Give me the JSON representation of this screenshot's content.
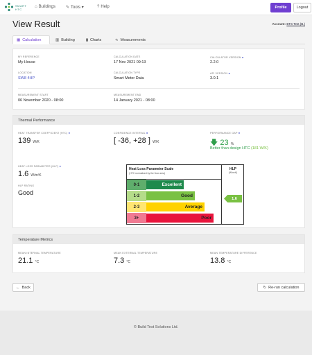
{
  "brand": {
    "line1": "SMART",
    "line2": "HTC"
  },
  "nav": [
    {
      "icon": "⌂",
      "label": "Buildings"
    },
    {
      "icon": "✎",
      "label": "Tools ▾"
    },
    {
      "icon": "?",
      "label": "Help"
    }
  ],
  "header": {
    "profile_label": "Profile",
    "logout_label": "Logout"
  },
  "page": {
    "title": "View Result",
    "account_label": "Account:",
    "account_value": "BTS Test (B.)"
  },
  "tabs": [
    {
      "label": "Calculation"
    },
    {
      "label": "Building"
    },
    {
      "label": "Charts"
    },
    {
      "label": "Measurements"
    }
  ],
  "details": {
    "reference": {
      "label": "My Reference",
      "value": "My House"
    },
    "calc_date": {
      "label": "Calculation Date",
      "value": "17 Nov 2021 09:13"
    },
    "calc_version": {
      "label": "Calculator Version",
      "value": "2.2.0"
    },
    "location": {
      "label": "Location",
      "value": "SW8 4HP"
    },
    "calc_type": {
      "label": "Calculation Type",
      "value": "Smart Meter Data"
    },
    "api_version": {
      "label": "API Version",
      "value": "3.0.1"
    },
    "measurement_start": {
      "label": "Measurement Start",
      "value": "06 November 2020 - 08:00"
    },
    "measurement_end": {
      "label": "Measurement End",
      "value": "14 January 2021 - 08:00"
    }
  },
  "thermal": {
    "title": "Thermal Performance",
    "htc": {
      "label": "Heat Transfer Coefficient (HTC)",
      "value": "139",
      "unit": "W/K"
    },
    "ci": {
      "label": "Confidence Interval",
      "value": "[ -36, +28 ]",
      "unit": "W/K"
    },
    "gap": {
      "label": "Performance Gap",
      "value": "23",
      "unit": "%",
      "note": "Better than design HTC",
      "note_value": "(181 W/K)"
    },
    "hlp": {
      "label": "Heat Loss Parameter (HLP)",
      "value": "1.6",
      "unit": "W/m²K"
    },
    "rating": {
      "label": "HLP Rating",
      "value": "Good"
    }
  },
  "hlp_scale": {
    "title": "Heat Loss Parameter Scale",
    "subtitle": "(HTC normalised by the floor area)",
    "col_title": "HLP",
    "col_unit": "(W/m²K)",
    "marker_value": "1.6",
    "bands": [
      {
        "range": "0-1",
        "label": "Excellent",
        "color": "#1e8a4c",
        "range_color": "#5fae6c"
      },
      {
        "range": "1-2",
        "label": "Good",
        "color": "#7ac143",
        "range_color": "#b5dc8a"
      },
      {
        "range": "2-3",
        "label": "Average",
        "color": "#ffd200",
        "range_color": "#ffe672"
      },
      {
        "range": "3+",
        "label": "Poor",
        "color": "#e8143c",
        "range_color": "#f07a92"
      }
    ]
  },
  "temperature": {
    "title": "Temperature Metrics",
    "internal": {
      "label": "Mean Internal Temperature",
      "value": "21.1",
      "unit": "°C"
    },
    "external": {
      "label": "Mean External Temperature",
      "value": "7.3",
      "unit": "°C"
    },
    "difference": {
      "label": "Mean Temperature Difference",
      "value": "13.8",
      "unit": "°C"
    }
  },
  "actions": {
    "back_label": "Back",
    "rerun_label": "Re-run calculation"
  },
  "footer": {
    "text": "© Build Test Solutions Ltd."
  },
  "colors": {
    "accent": "#6f3fd1",
    "link": "#4a56c8",
    "good": "#2e9e4a"
  }
}
